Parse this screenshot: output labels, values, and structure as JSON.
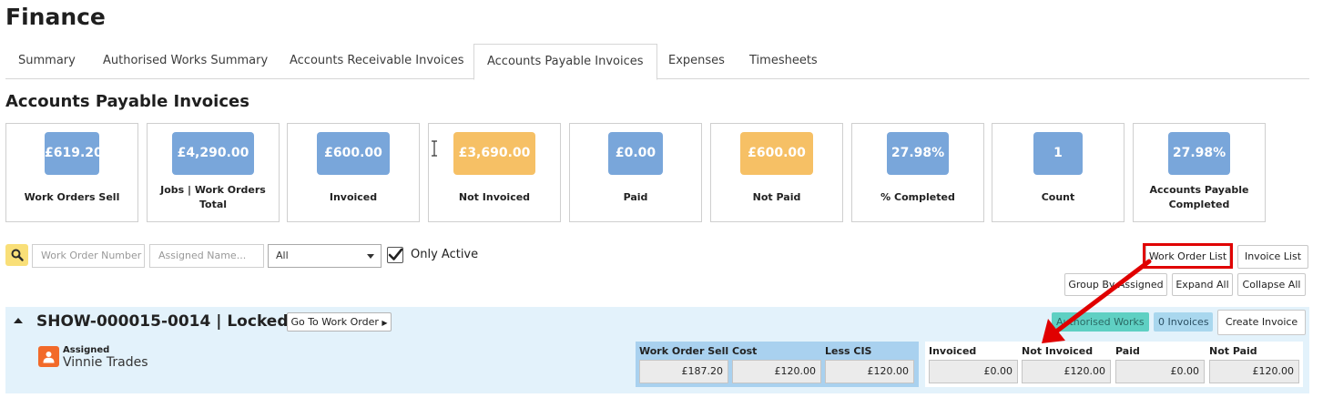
{
  "page": {
    "title": "Finance"
  },
  "tabs": [
    {
      "label": "Summary"
    },
    {
      "label": "Authorised Works Summary"
    },
    {
      "label": "Accounts Receivable Invoices"
    },
    {
      "label": "Accounts Payable Invoices",
      "active": true
    },
    {
      "label": "Expenses"
    },
    {
      "label": "Timesheets"
    }
  ],
  "section": {
    "title": "Accounts Payable Invoices"
  },
  "cards": [
    {
      "value": "£619.20",
      "label": "Work Orders Sell",
      "color": "#79a6da"
    },
    {
      "value": "£4,290.00",
      "label": "Jobs | Work Orders Total",
      "color": "#79a6da"
    },
    {
      "value": "£600.00",
      "label": "Invoiced",
      "color": "#79a6da"
    },
    {
      "value": "£3,690.00",
      "label": "Not Invoiced",
      "color": "#f6c065"
    },
    {
      "value": "£0.00",
      "label": "Paid",
      "color": "#79a6da"
    },
    {
      "value": "£600.00",
      "label": "Not Paid",
      "color": "#f6c065"
    },
    {
      "value": "27.98%",
      "label": "% Completed",
      "color": "#79a6da"
    },
    {
      "value": "1",
      "label": "Count",
      "color": "#79a6da"
    },
    {
      "value": "27.98%",
      "label": "Accounts Payable Completed",
      "color": "#79a6da"
    }
  ],
  "filters": {
    "search_icon": "search-icon",
    "work_order_placeholder": "Work Order Number",
    "assigned_placeholder": "Assigned Name...",
    "status_selected": "All",
    "only_active_label": "Only Active",
    "only_active_checked": true
  },
  "view_buttons": {
    "work_order_list": "Work Order List",
    "invoice_list": "Invoice List",
    "group_by_assigned": "Group By Assigned",
    "expand_all": "Expand All",
    "collapse_all": "Collapse All"
  },
  "work_order": {
    "title": "SHOW-000015-0014 | Locked",
    "go_to_label": "Go To Work Order",
    "tag_authorised": "Authorised Works",
    "tag_invoices": "0 Invoices",
    "create_invoice": "Create Invoice",
    "assigned_label": "Assigned",
    "assigned_name": "Vinnie Trades",
    "costs": [
      {
        "label": "Work Order Sell",
        "value": "£187.20"
      },
      {
        "label": "Cost",
        "value": "£120.00"
      },
      {
        "label": "Less CIS",
        "value": "£120.00"
      }
    ],
    "invoicing": [
      {
        "label": "Invoiced",
        "value": "£0.00"
      },
      {
        "label": "Not Invoiced",
        "value": "£120.00"
      },
      {
        "label": "Paid",
        "value": "£0.00"
      },
      {
        "label": "Not Paid",
        "value": "£120.00"
      }
    ]
  },
  "colors": {
    "accent_blue": "#79a6da",
    "accent_amber": "#f6c065",
    "annotation_red": "#e00000",
    "panel_bg": "#e3f2fb"
  }
}
